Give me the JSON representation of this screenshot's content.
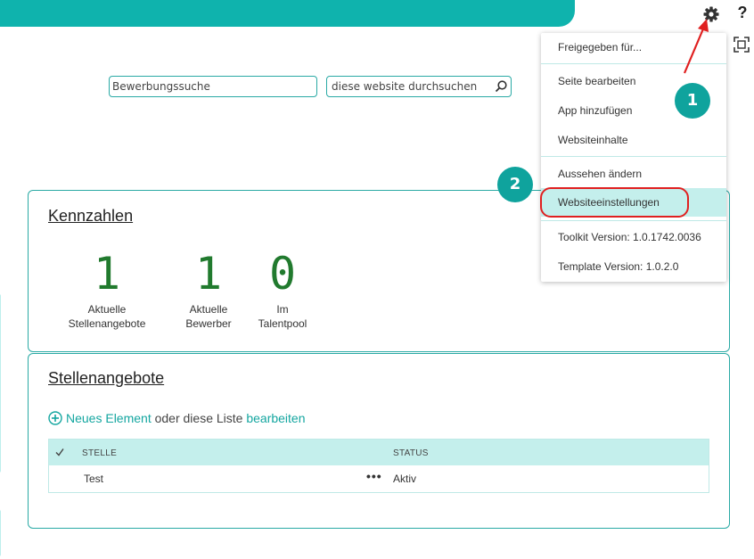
{
  "header": {
    "banner_color": "#0fb3ad",
    "settings_icon": "gear-icon",
    "help_label": "?",
    "focus_icon": "focus-mode-icon"
  },
  "search": {
    "applicant_search_value": "Bewerbungssuche",
    "site_search_value": "diese website durchsuchen",
    "site_search_icon": "search-icon"
  },
  "kpi_panel": {
    "title": "Kennzahlen",
    "items": [
      {
        "value": "1",
        "label_line1": "Aktuelle",
        "label_line2": "Stellenangebote"
      },
      {
        "value": "1",
        "label_line1": "Aktuelle",
        "label_line2": "Bewerber"
      },
      {
        "value": "0",
        "label_line1": "Im",
        "label_line2": "Talentpool"
      }
    ]
  },
  "jobs_panel": {
    "title": "Stellenangebote",
    "new_item_link": "Neues Element",
    "middle_text": " oder diese Liste ",
    "edit_link": "bearbeiten",
    "columns": [
      "STELLE",
      "STATUS"
    ],
    "rows": [
      {
        "stelle": "Test",
        "more": "•••",
        "status": "Aktiv"
      }
    ]
  },
  "settings_menu": {
    "items": [
      "Freigegeben für...",
      "Seite bearbeiten",
      "App hinzufügen",
      "Websiteinhalte",
      "Aussehen ändern",
      "Websiteeinstellungen",
      "Toolkit Version: 1.0.1742.0036",
      "Template Version: 1.0.2.0"
    ],
    "highlighted": "Websiteeinstellungen"
  },
  "annotations": {
    "step_1": "1",
    "step_2": "2",
    "ring_color": "#e02020"
  }
}
